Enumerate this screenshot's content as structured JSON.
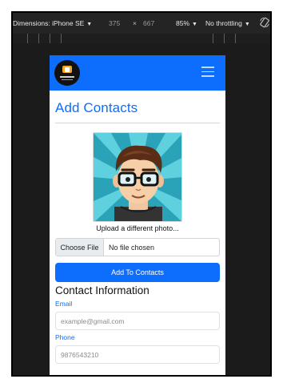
{
  "devtools": {
    "dimensions_label": "Dimensions: iPhone SE",
    "width": "375",
    "times": "×",
    "height": "667",
    "zoom": "85%",
    "throttling": "No throttling"
  },
  "page": {
    "title": "Add Contacts",
    "upload_label": "Upload a different photo...",
    "file": {
      "button_label": "Choose File",
      "status": "No file chosen"
    },
    "submit_label": "Add To Contacts",
    "section_title": "Contact Information",
    "email": {
      "label": "Email",
      "placeholder": "example@gmail.com"
    },
    "phone": {
      "label": "Phone",
      "value": "9876543210"
    }
  },
  "colors": {
    "brand": "#0d6efd",
    "navbar": "#0d6efd"
  },
  "icons": {
    "rotate": "rotate-device-icon",
    "menu": "hamburger-menu-icon",
    "logo": "logo-icon",
    "avatar": "avatar-illustration"
  }
}
